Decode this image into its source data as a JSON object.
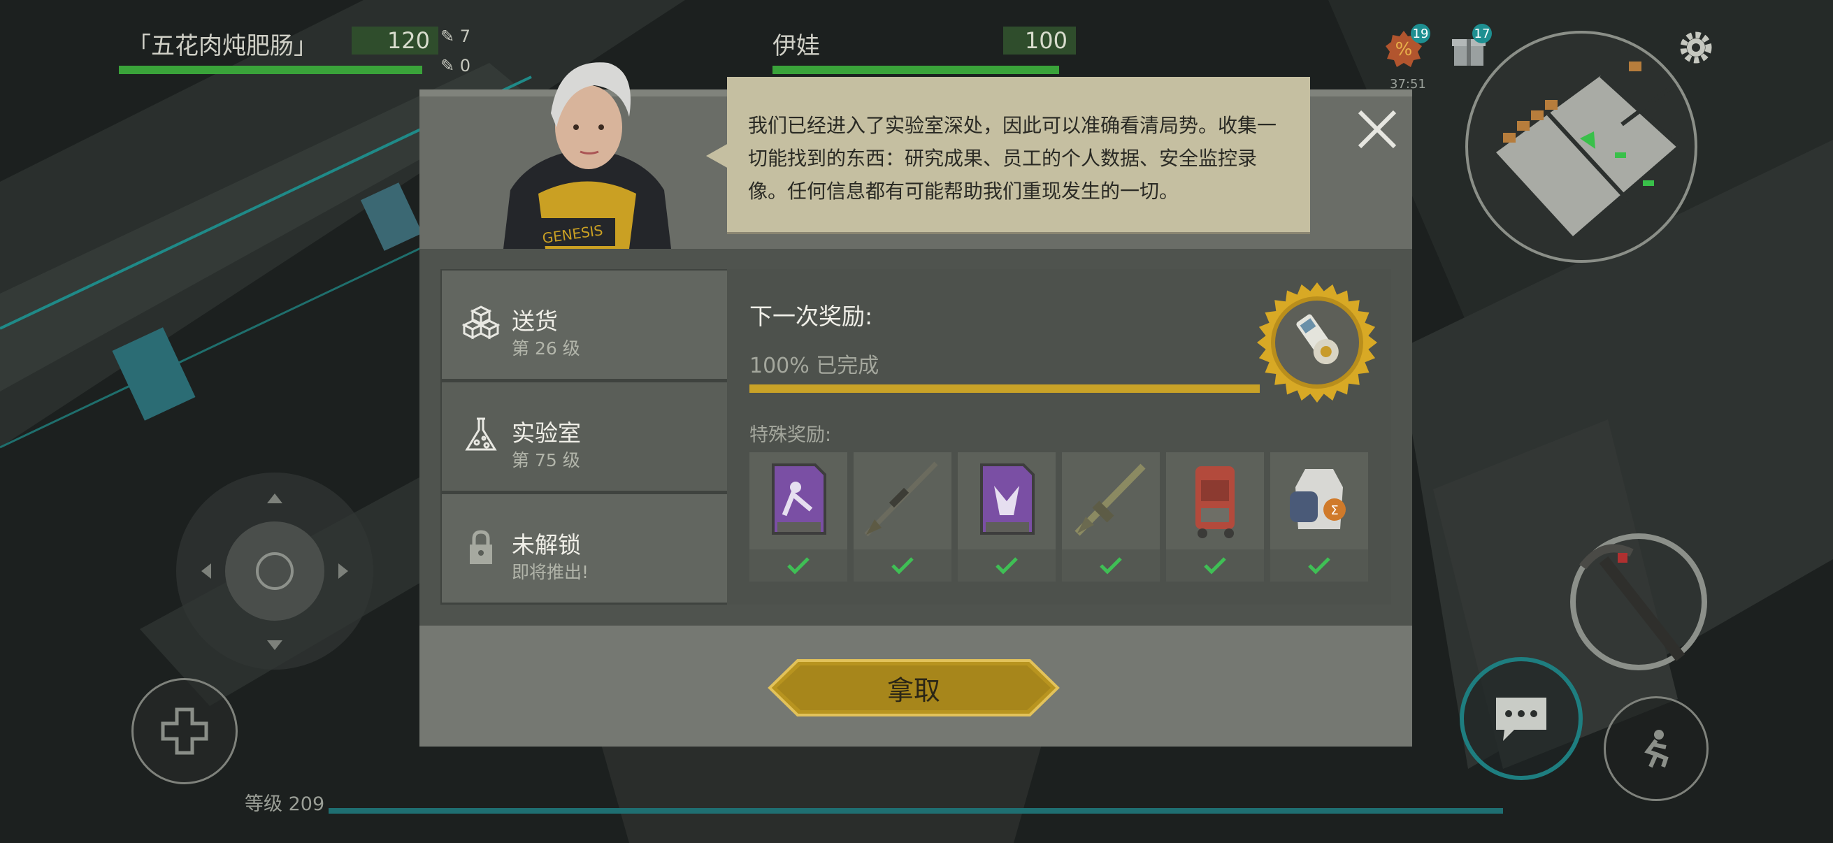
{
  "hud": {
    "player1": {
      "name": "「五花肉炖肥肠」",
      "hp": "120",
      "stat_a": "7",
      "stat_b": "0"
    },
    "player2": {
      "name": "伊娃",
      "hp": "100"
    },
    "badges": {
      "discount_count": "19",
      "gift_count": "17",
      "timer": "37:51"
    },
    "level_label": "等级 209"
  },
  "dialog": {
    "speech": "我们已经进入了实验室深处，因此可以准确看清局势。收集一切能找到的东西：研究成果、员工的个人数据、安全监控录像。任何信息都有可能帮助我们重现发生的一切。",
    "tabs": [
      {
        "title": "送货",
        "subtitle": "第 26 级",
        "icon": "boxes-icon"
      },
      {
        "title": "实验室",
        "subtitle": "第 75 级",
        "icon": "flask-icon"
      },
      {
        "title": "未解锁",
        "subtitle": "即将推出!",
        "icon": "lock-icon"
      }
    ],
    "next_reward_label": "下一次奖励:",
    "progress_text": "100% 已完成",
    "progress": 1.0,
    "special_rewards_label": "特殊奖励:",
    "rewards": [
      {
        "icon": "skill-card-icon",
        "claimed": true
      },
      {
        "icon": "sniper-rifle-icon",
        "claimed": true
      },
      {
        "icon": "skill-card-icon",
        "claimed": true
      },
      {
        "icon": "assault-rifle-icon",
        "claimed": true
      },
      {
        "icon": "backpack-icon",
        "claimed": true
      },
      {
        "icon": "vest-icon",
        "claimed": true
      }
    ],
    "take_button": "拿取"
  },
  "colors": {
    "accent_gold": "#c9a227",
    "check_green": "#3fbf55",
    "hp_green": "#3aa33a"
  }
}
